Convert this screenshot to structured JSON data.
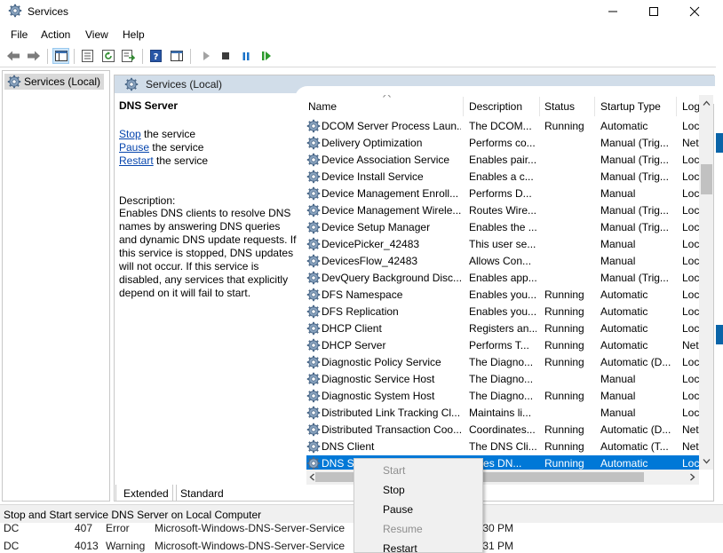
{
  "window": {
    "title": "Services",
    "icon": "services-gear-icon"
  },
  "menu": [
    "File",
    "Action",
    "View",
    "Help"
  ],
  "tree": {
    "root_label": "Services (Local)"
  },
  "pane": {
    "header_title": "Services (Local)",
    "service_name": "DNS Server",
    "actions": [
      {
        "link": "Stop",
        "rest": " the service"
      },
      {
        "link": "Pause",
        "rest": " the service"
      },
      {
        "link": "Restart",
        "rest": " the service"
      }
    ],
    "description_label": "Description:",
    "description_text": "Enables DNS clients to resolve DNS names by answering DNS queries and dynamic DNS update requests. If this service is stopped, DNS updates will not occur. If this service is disabled, any services that explicitly depend on it will fail to start."
  },
  "columns": [
    "Name",
    "Description",
    "Status",
    "Startup Type",
    "Log"
  ],
  "rows": [
    {
      "name": "DCOM Server Process Laun...",
      "description": "The DCOM...",
      "status": "Running",
      "startup": "Automatic",
      "log": "Loc"
    },
    {
      "name": "Delivery Optimization",
      "description": "Performs co...",
      "status": "",
      "startup": "Manual (Trig...",
      "log": "Net"
    },
    {
      "name": "Device Association Service",
      "description": "Enables pair...",
      "status": "",
      "startup": "Manual (Trig...",
      "log": "Loc"
    },
    {
      "name": "Device Install Service",
      "description": "Enables a c...",
      "status": "",
      "startup": "Manual (Trig...",
      "log": "Loc"
    },
    {
      "name": "Device Management Enroll...",
      "description": "Performs D...",
      "status": "",
      "startup": "Manual",
      "log": "Loc"
    },
    {
      "name": "Device Management Wirele...",
      "description": "Routes Wire...",
      "status": "",
      "startup": "Manual (Trig...",
      "log": "Loc"
    },
    {
      "name": "Device Setup Manager",
      "description": "Enables the ...",
      "status": "",
      "startup": "Manual (Trig...",
      "log": "Loc"
    },
    {
      "name": "DevicePicker_42483",
      "description": "This user se...",
      "status": "",
      "startup": "Manual",
      "log": "Loc"
    },
    {
      "name": "DevicesFlow_42483",
      "description": "Allows Con...",
      "status": "",
      "startup": "Manual",
      "log": "Loc"
    },
    {
      "name": "DevQuery Background Disc...",
      "description": "Enables app...",
      "status": "",
      "startup": "Manual (Trig...",
      "log": "Loc"
    },
    {
      "name": "DFS Namespace",
      "description": "Enables you...",
      "status": "Running",
      "startup": "Automatic",
      "log": "Loc"
    },
    {
      "name": "DFS Replication",
      "description": "Enables you...",
      "status": "Running",
      "startup": "Automatic",
      "log": "Loc"
    },
    {
      "name": "DHCP Client",
      "description": "Registers an...",
      "status": "Running",
      "startup": "Automatic",
      "log": "Loc"
    },
    {
      "name": "DHCP Server",
      "description": "Performs T...",
      "status": "Running",
      "startup": "Automatic",
      "log": "Net"
    },
    {
      "name": "Diagnostic Policy Service",
      "description": "The Diagno...",
      "status": "Running",
      "startup": "Automatic (D...",
      "log": "Loc"
    },
    {
      "name": "Diagnostic Service Host",
      "description": "The Diagno...",
      "status": "",
      "startup": "Manual",
      "log": "Loc"
    },
    {
      "name": "Diagnostic System Host",
      "description": "The Diagno...",
      "status": "Running",
      "startup": "Manual",
      "log": "Loc"
    },
    {
      "name": "Distributed Link Tracking Cl...",
      "description": "Maintains li...",
      "status": "",
      "startup": "Manual",
      "log": "Loc"
    },
    {
      "name": "Distributed Transaction Coo...",
      "description": "Coordinates...",
      "status": "Running",
      "startup": "Automatic (D...",
      "log": "Net"
    },
    {
      "name": "DNS Client",
      "description": "The DNS Cli...",
      "status": "Running",
      "startup": "Automatic (T...",
      "log": "Net"
    },
    {
      "name": "DNS S",
      "description": "ables DN...",
      "status": "Running",
      "startup": "Automatic",
      "log": "Loc",
      "selected": true
    }
  ],
  "tabs": [
    "Extended",
    "Standard"
  ],
  "status_bar": "Stop and Start service DNS Server on Local Computer",
  "background_rows": [
    {
      "a": "DC",
      "b": "407",
      "c": "Error",
      "d": "Microsoft-Windows-DNS-Server-Service",
      "e": ":30 PM"
    },
    {
      "a": "DC",
      "b": "4013",
      "c": "Warning",
      "d": "Microsoft-Windows-DNS-Server-Service",
      "e": ":31 PM"
    }
  ],
  "context_menu": [
    {
      "label": "Start",
      "enabled": false
    },
    {
      "label": "Stop",
      "enabled": true
    },
    {
      "label": "Pause",
      "enabled": true
    },
    {
      "label": "Resume",
      "enabled": false
    },
    {
      "label": "Restart",
      "enabled": true
    }
  ],
  "colors": {
    "selection": "#0078d7",
    "pane_header": "#d1dde9",
    "link": "#0645ad"
  }
}
